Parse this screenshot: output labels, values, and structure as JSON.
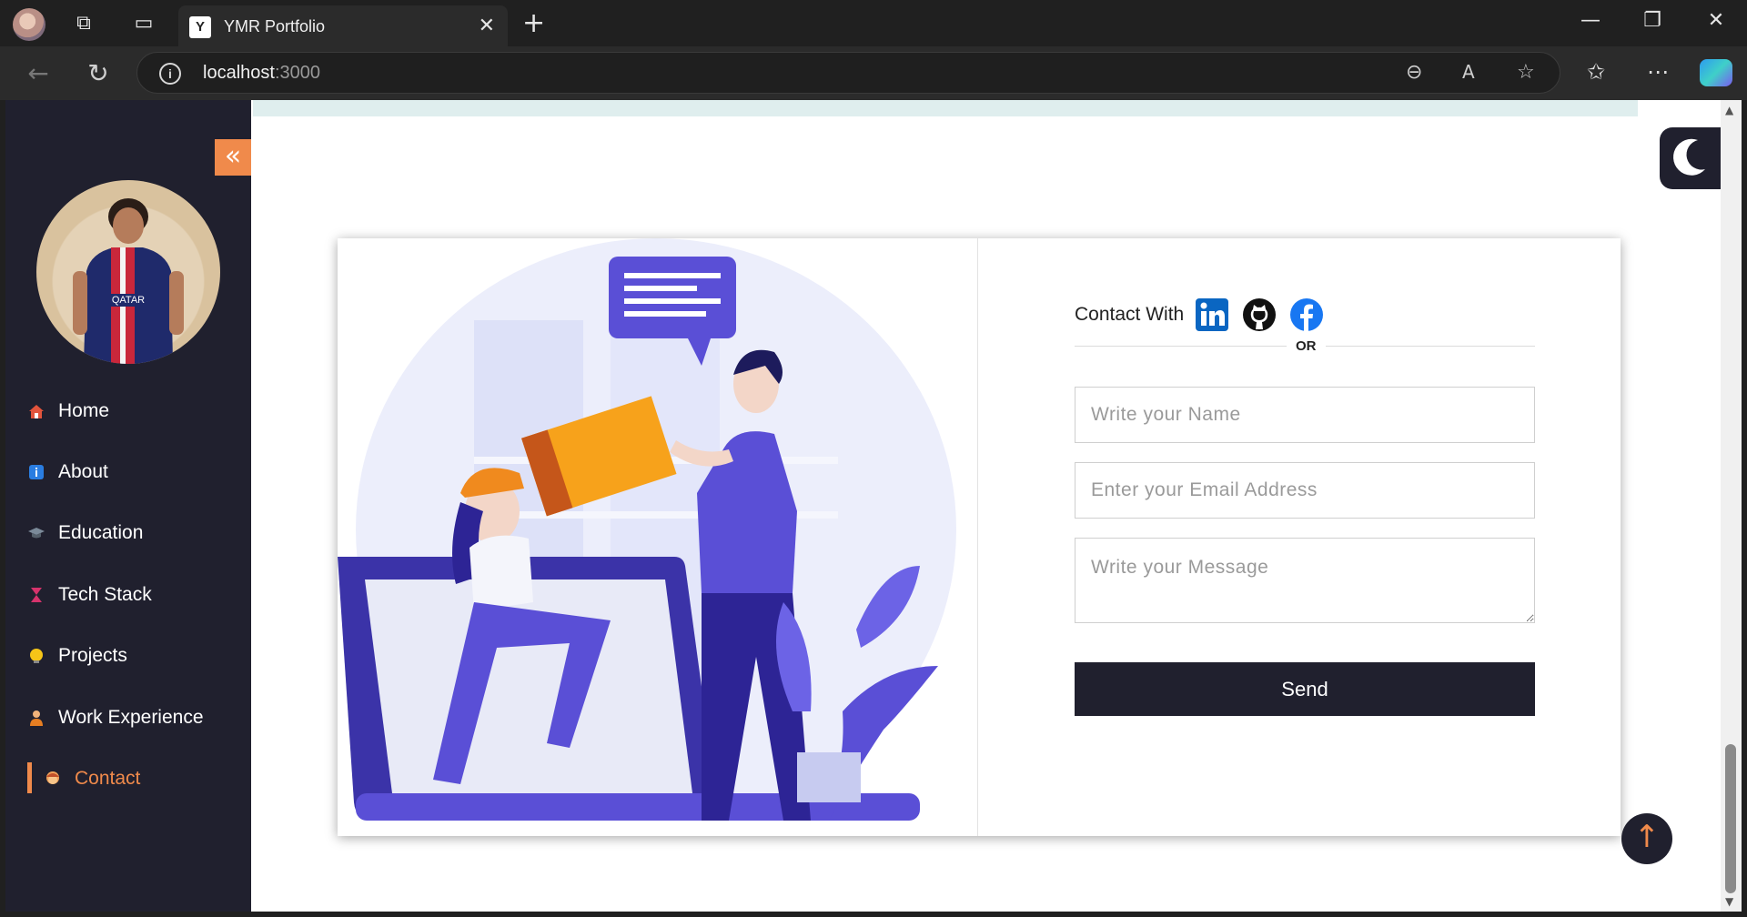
{
  "browser": {
    "tab_title": "YMR Portfolio",
    "tab_favicon": "Y",
    "url_host": "localhost",
    "url_port": ":3000"
  },
  "sidebar": {
    "items": [
      {
        "label": "Home",
        "icon": "house-icon"
      },
      {
        "label": "About",
        "icon": "info-icon"
      },
      {
        "label": "Education",
        "icon": "graduation-cap-icon"
      },
      {
        "label": "Tech Stack",
        "icon": "hourglass-icon"
      },
      {
        "label": "Projects",
        "icon": "lightbulb-icon"
      },
      {
        "label": "Work Experience",
        "icon": "worker-icon"
      },
      {
        "label": "Contact",
        "icon": "person-icon",
        "active": true
      }
    ]
  },
  "contact": {
    "label": "Contact With",
    "or": "OR",
    "name_placeholder": "Write your Name",
    "email_placeholder": "Enter your Email Address",
    "message_placeholder": "Write your Message",
    "send_label": "Send",
    "socials": [
      "linkedin-icon",
      "github-icon",
      "facebook-icon"
    ]
  },
  "colors": {
    "sidebar_bg": "#20202e",
    "accent": "#f08a4b",
    "illustration_primary": "#5a4fd6",
    "illustration_orange": "#f7a21b"
  }
}
